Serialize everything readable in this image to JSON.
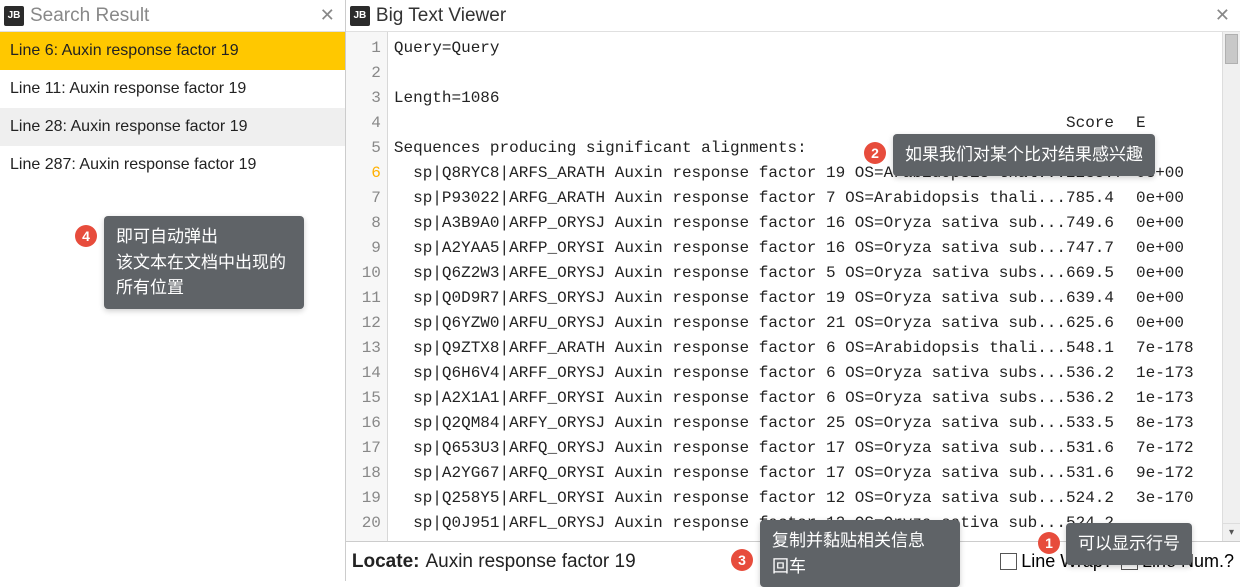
{
  "leftPanel": {
    "title": "Search Result",
    "jbIcon": "JB",
    "items": [
      {
        "label": "Line 6: Auxin response factor 19",
        "selected": true
      },
      {
        "label": "Line 11: Auxin response factor 19",
        "selected": false
      },
      {
        "label": "Line 28: Auxin response factor 19",
        "selected": false
      },
      {
        "label": "Line 287: Auxin response factor 19",
        "selected": false
      }
    ]
  },
  "rightPanel": {
    "title": "Big Text Viewer",
    "jbIcon": "JB",
    "lines": [
      {
        "n": 1,
        "text": "Query=Query"
      },
      {
        "n": 2,
        "text": ""
      },
      {
        "n": 3,
        "text": "Length=1086"
      },
      {
        "n": 4,
        "text": "",
        "score_header": "Score",
        "e_header": "E"
      },
      {
        "n": 5,
        "text": "Sequences producing significant alignments:"
      },
      {
        "n": 6,
        "text": "  sp|Q8RYC8|ARFS_ARATH Auxin response factor 19 OS=Arabidopsis thal...",
        "score": "2235.7",
        "e": "0e+00",
        "hl": true
      },
      {
        "n": 7,
        "text": "  sp|P93022|ARFG_ARATH Auxin response factor 7 OS=Arabidopsis thali...",
        "score": "785.4",
        "e": "0e+00"
      },
      {
        "n": 8,
        "text": "  sp|A3B9A0|ARFP_ORYSJ Auxin response factor 16 OS=Oryza sativa sub...",
        "score": "749.6",
        "e": "0e+00"
      },
      {
        "n": 9,
        "text": "  sp|A2YAA5|ARFP_ORYSI Auxin response factor 16 OS=Oryza sativa sub...",
        "score": "747.7",
        "e": "0e+00"
      },
      {
        "n": 10,
        "text": "  sp|Q6Z2W3|ARFE_ORYSJ Auxin response factor 5 OS=Oryza sativa subs...",
        "score": "669.5",
        "e": "0e+00"
      },
      {
        "n": 11,
        "text": "  sp|Q0D9R7|ARFS_ORYSJ Auxin response factor 19 OS=Oryza sativa sub...",
        "score": "639.4",
        "e": "0e+00"
      },
      {
        "n": 12,
        "text": "  sp|Q6YZW0|ARFU_ORYSJ Auxin response factor 21 OS=Oryza sativa sub...",
        "score": "625.6",
        "e": "0e+00"
      },
      {
        "n": 13,
        "text": "  sp|Q9ZTX8|ARFF_ARATH Auxin response factor 6 OS=Arabidopsis thali...",
        "score": "548.1",
        "e": "7e-178"
      },
      {
        "n": 14,
        "text": "  sp|Q6H6V4|ARFF_ORYSJ Auxin response factor 6 OS=Oryza sativa subs...",
        "score": "536.2",
        "e": "1e-173"
      },
      {
        "n": 15,
        "text": "  sp|A2X1A1|ARFF_ORYSI Auxin response factor 6 OS=Oryza sativa subs...",
        "score": "536.2",
        "e": "1e-173"
      },
      {
        "n": 16,
        "text": "  sp|Q2QM84|ARFY_ORYSJ Auxin response factor 25 OS=Oryza sativa sub...",
        "score": "533.5",
        "e": "8e-173"
      },
      {
        "n": 17,
        "text": "  sp|Q653U3|ARFQ_ORYSJ Auxin response factor 17 OS=Oryza sativa sub...",
        "score": "531.6",
        "e": "7e-172"
      },
      {
        "n": 18,
        "text": "  sp|A2YG67|ARFQ_ORYSI Auxin response factor 17 OS=Oryza sativa sub...",
        "score": "531.6",
        "e": "9e-172"
      },
      {
        "n": 19,
        "text": "  sp|Q258Y5|ARFL_ORYSI Auxin response factor 12 OS=Oryza sativa sub...",
        "score": "524.2",
        "e": "3e-170"
      },
      {
        "n": 20,
        "text": "  sp|Q0J951|ARFL_ORYSJ Auxin response factor 12 OS=Oryza sativa sub...",
        "score": "524.2",
        "e": ""
      }
    ]
  },
  "bottombar": {
    "locateLabel": "Locate:",
    "locateValue": "Auxin response factor 19",
    "lineWrapLabel": "Line Wrap?",
    "lineWrapChecked": false,
    "lineNumLabel": "Line Num.?",
    "lineNumChecked": true
  },
  "tips": {
    "t1": {
      "num": "1",
      "text": "可以显示行号"
    },
    "t2": {
      "num": "2",
      "text": "如果我们对某个比对结果感兴趣"
    },
    "t3": {
      "num": "3",
      "text1": "复制并黏贴相关信息",
      "text2": "回车"
    },
    "t4": {
      "num": "4",
      "text1": "即可自动弹出",
      "text2": "该文本在文档中出现的",
      "text3": "所有位置"
    }
  }
}
